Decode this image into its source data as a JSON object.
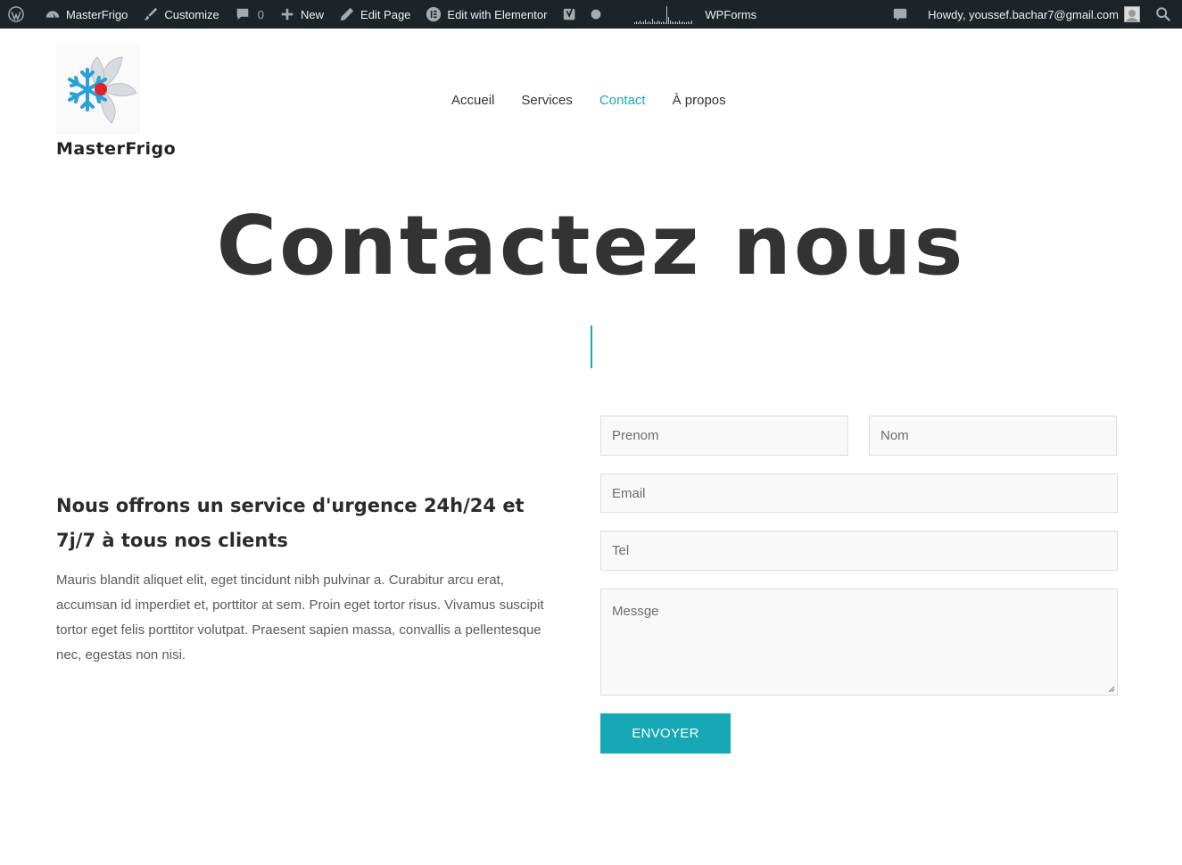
{
  "admin_bar": {
    "site_name": "MasterFrigo",
    "customize": "Customize",
    "comments_count": "0",
    "new": "New",
    "edit_page": "Edit Page",
    "edit_elementor": "Edit with Elementor",
    "wpforms": "WPForms",
    "howdy": "Howdy, youssef.bachar7@gmail.com"
  },
  "header": {
    "brand": "MasterFrigo",
    "nav": [
      "Accueil",
      "Services",
      "Contact",
      "À propos"
    ],
    "active_nav": "Contact"
  },
  "hero": {
    "title": "Contactez nous"
  },
  "left": {
    "heading": "Nous offrons un service d'urgence 24h/24 et 7j/7 à tous nos clients",
    "text": "Mauris blandit aliquet elit, eget tincidunt nibh pulvinar a. Curabitur arcu erat, accumsan id imperdiet et, porttitor at sem. Proin eget tortor risus. Vivamus suscipit tortor eget felis porttitor volutpat. Praesent sapien massa, convallis a pellentesque nec, egestas non nisi."
  },
  "form": {
    "prenom_placeholder": "Prenom",
    "nom_placeholder": "Nom",
    "email_placeholder": "Email",
    "tel_placeholder": "Tel",
    "message_placeholder": "Messge",
    "submit": "ENVOYER"
  },
  "colors": {
    "accent": "#17a8b5",
    "admin_bar": "#1d2327"
  }
}
